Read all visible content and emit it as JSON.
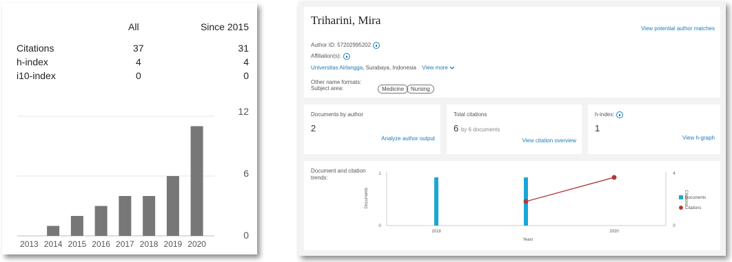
{
  "scholar": {
    "headers": [
      "All",
      "Since 2015"
    ],
    "rows": [
      {
        "label": "Citations",
        "all": "37",
        "since": "31"
      },
      {
        "label": "h-index",
        "all": "4",
        "since": "4"
      },
      {
        "label": "i10-index",
        "all": "0",
        "since": "0"
      }
    ],
    "y_ticks": [
      "12",
      "6",
      "0"
    ],
    "bar_color": "#777777"
  },
  "scopus": {
    "author_name": "Triharini, Mira",
    "view_matches": "View potential author matches",
    "author_id": "Author ID: 57202995202",
    "affiliations_label": "Affiliation(s):",
    "affiliation_link": "Universitas Airlangga",
    "affiliation_rest": ", Surabaya, Indonesia",
    "view_more": "View more",
    "other_name_formats": "Other name formats:",
    "subject_area_label": "Subject area:",
    "subjects": [
      "Medicine",
      "Nursing"
    ],
    "docs_title": "Documents by author",
    "docs_value": "2",
    "docs_link": "Analyze author output",
    "cit_title": "Total citations",
    "cit_value": "6",
    "cit_suffix": "by 6 documents",
    "cit_link": "View citation overview",
    "h_title": "h-index:",
    "h_value": "1",
    "h_link": "View h-graph",
    "trends_title": "Document and citation trends:",
    "accent": "#1b7bb8"
  },
  "chart_data": [
    {
      "type": "bar",
      "categories": [
        "2013",
        "2014",
        "2015",
        "2016",
        "2017",
        "2018",
        "2019",
        "2020"
      ],
      "values": [
        0,
        1,
        2,
        3,
        4,
        4,
        6,
        11
      ],
      "ylim": [
        0,
        12
      ],
      "y_ticks": [
        0,
        6,
        12
      ],
      "grid": true
    },
    {
      "type": "bar+line",
      "x_ticks": [
        "2018",
        "2020"
      ],
      "xlabel": "Years",
      "ylabel_left": "Documents",
      "ylabel_right": "Citations",
      "left_ticks": [
        "1",
        "0"
      ],
      "right_ticks": [
        "4",
        "0"
      ],
      "series": [
        {
          "name": "Documents",
          "color": "#1aa7d6",
          "x": [
            2018,
            2019
          ],
          "values": [
            1,
            1
          ]
        },
        {
          "name": "Citations",
          "color": "#b23a3a",
          "x": [
            2019,
            2020
          ],
          "values": [
            2,
            4
          ]
        }
      ],
      "legend": "right"
    }
  ]
}
